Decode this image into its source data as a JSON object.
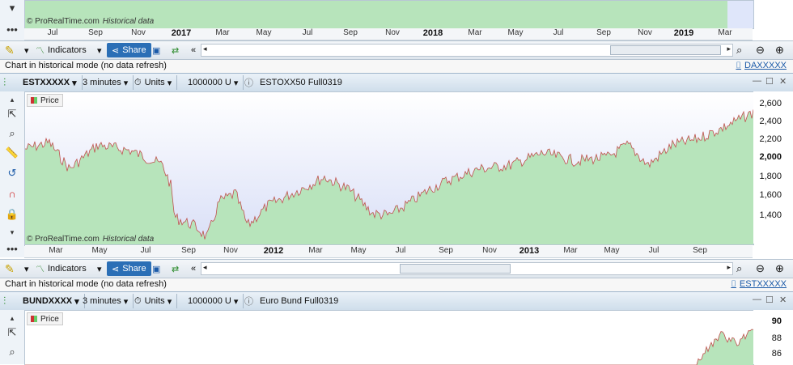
{
  "top_panel": {
    "watermark": "© ProRealTime.com",
    "watermark_sub": "Historical data",
    "xaxis": [
      "Jul",
      "Sep",
      "Nov",
      "2017",
      "Mar",
      "May",
      "Jul",
      "Sep",
      "Nov",
      "2018",
      "Mar",
      "May",
      "Jul",
      "Sep",
      "Nov",
      "2019",
      "Mar"
    ],
    "toolbar": {
      "indicators": "Indicators",
      "share": "Share"
    },
    "status": "Chart in historical mode (no data refresh)",
    "link": "DAXXXXX"
  },
  "mid_panel": {
    "symbol": "ESTXXXXX",
    "interval": "3 minutes",
    "units": "Units",
    "size": "1000000 U",
    "name": "ESTOXX50 Full0319",
    "legend": "Price",
    "yticks": [
      "2,600",
      "2,400",
      "2,200",
      "2,000",
      "1,800",
      "1,600",
      "1,400"
    ],
    "xaxis": [
      "Mar",
      "May",
      "Jul",
      "Sep",
      "Nov",
      "2012",
      "Mar",
      "May",
      "Jul",
      "Sep",
      "Nov",
      "2013",
      "Mar",
      "May",
      "Jul",
      "Sep"
    ],
    "watermark": "© ProRealTime.com",
    "watermark_sub": "Historical data",
    "toolbar": {
      "indicators": "Indicators",
      "share": "Share"
    },
    "status": "Chart in historical mode (no data refresh)",
    "link": "ESTXXXXX"
  },
  "bottom_panel": {
    "symbol": "BUNDXXXX",
    "interval": "3 minutes",
    "units": "Units",
    "size": "1000000 U",
    "name": "Euro Bund Full0319",
    "legend": "Price",
    "yticks": [
      "90",
      "88",
      "86"
    ]
  },
  "colors": {
    "area": "#b7e4bb",
    "line": "#c0504d",
    "accent": "#2b6fb6"
  }
}
